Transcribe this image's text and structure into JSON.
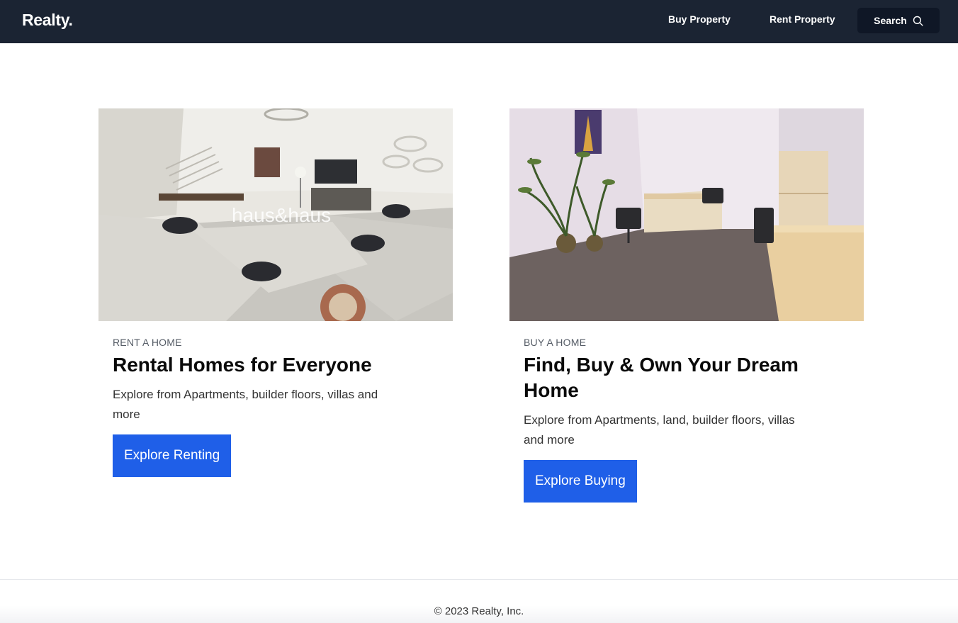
{
  "nav": {
    "brand": "Realty.",
    "links": [
      {
        "label": "Buy Property"
      },
      {
        "label": "Rent Property"
      }
    ],
    "search_label": "Search",
    "search_icon": "search-icon"
  },
  "cards": [
    {
      "eyebrow": "RENT A HOME",
      "title": "Rental Homes for Everyone",
      "description": "Explore from Apartments, builder floors, villas and more",
      "button": "Explore Renting"
    },
    {
      "eyebrow": "BUY A HOME",
      "title": "Find, Buy & Own Your Dream Home",
      "description": "Explore from Apartments, land, builder floors, villas and more",
      "button": "Explore Buying"
    }
  ],
  "footer": {
    "copyright": "© 2023 Realty, Inc."
  },
  "colors": {
    "navbar": "#1b2433",
    "search_button": "#0f1726",
    "cta": "#1f5fe8"
  }
}
